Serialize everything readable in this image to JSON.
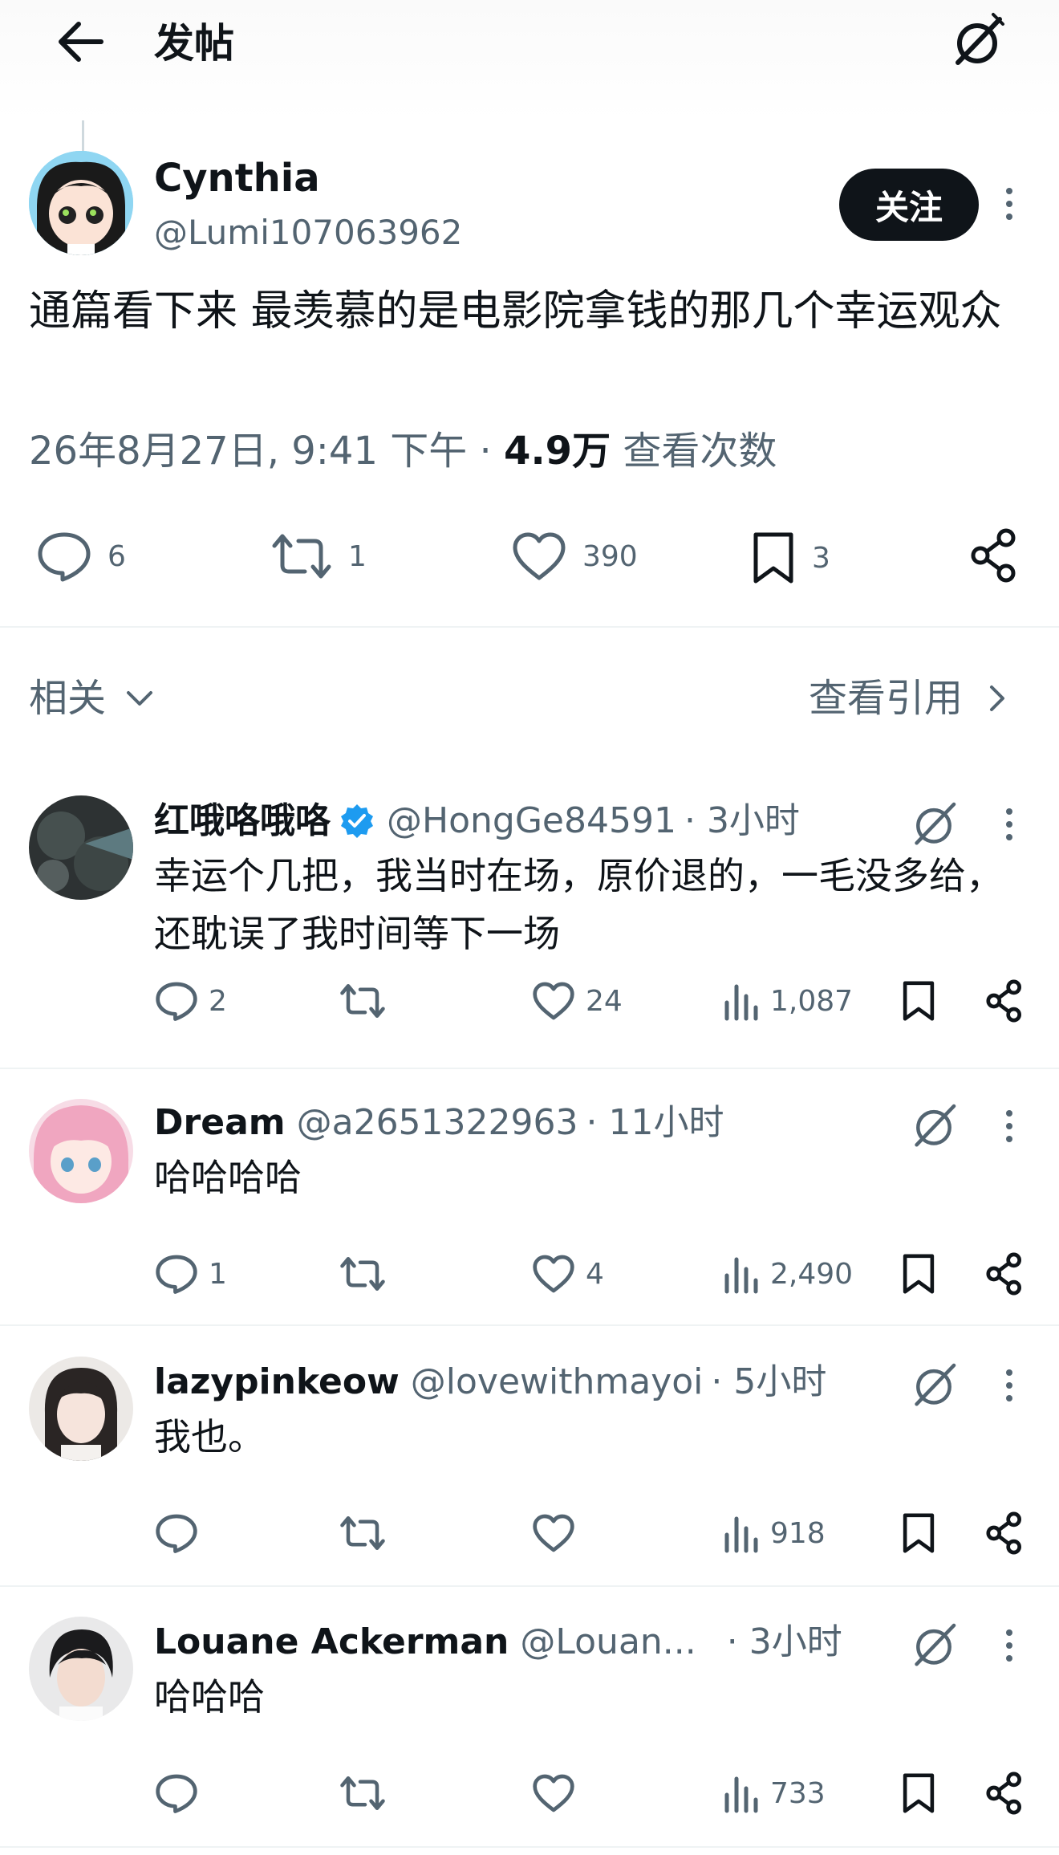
{
  "header": {
    "title": "发帖"
  },
  "post": {
    "author_name": "Cynthia",
    "author_handle": "@Lumi107063962",
    "follow_label": "关注",
    "text": "通篇看下来 最羡慕的是电影院拿钱的那几个幸运观众",
    "timestamp": "26年8月27日, 9:41 下午",
    "separator": " · ",
    "views_count": "4.9万",
    "views_label": " 查看次数",
    "stats": {
      "replies": "6",
      "reposts": "1",
      "likes": "390",
      "bookmarks": "3"
    }
  },
  "related": {
    "label": "相关",
    "quotes_label": "查看引用"
  },
  "replies": [
    {
      "name": "红哦咯哦咯",
      "verified": true,
      "handle": "@HongGe84591",
      "time": "· 3小时",
      "text": "幸运个几把，我当时在场，原价退的，一毛没多给，还耽误了我时间等下一场",
      "replies": "2",
      "reposts": "",
      "likes": "24",
      "views": "1,087"
    },
    {
      "name": "Dream",
      "verified": false,
      "handle": "@a2651322963",
      "time": "· 11小时",
      "text": "哈哈哈哈",
      "replies": "1",
      "reposts": "",
      "likes": "4",
      "views": "2,490"
    },
    {
      "name": "lazypinkeow",
      "verified": false,
      "handle": "@lovewithmayoi",
      "time": "· 5小时",
      "text": "我也。",
      "replies": "",
      "reposts": "",
      "likes": "",
      "views": "918"
    },
    {
      "name": "Louane Ackerman",
      "verified": false,
      "handle": "@Louan...",
      "time": "· 3小时",
      "text": "哈哈哈",
      "replies": "",
      "reposts": "",
      "likes": "",
      "views": "733"
    }
  ],
  "colors": {
    "text": "#0f1419",
    "secondary": "#536471",
    "verified": "#1d9bf0",
    "divider": "#eff3f4"
  },
  "icons": [
    "back-arrow-icon",
    "grok-icon",
    "more-icon",
    "reply-icon",
    "repost-icon",
    "like-icon",
    "bookmark-icon",
    "share-icon",
    "views-icon",
    "verified-icon",
    "chevron-down-icon",
    "chevron-right-icon"
  ]
}
